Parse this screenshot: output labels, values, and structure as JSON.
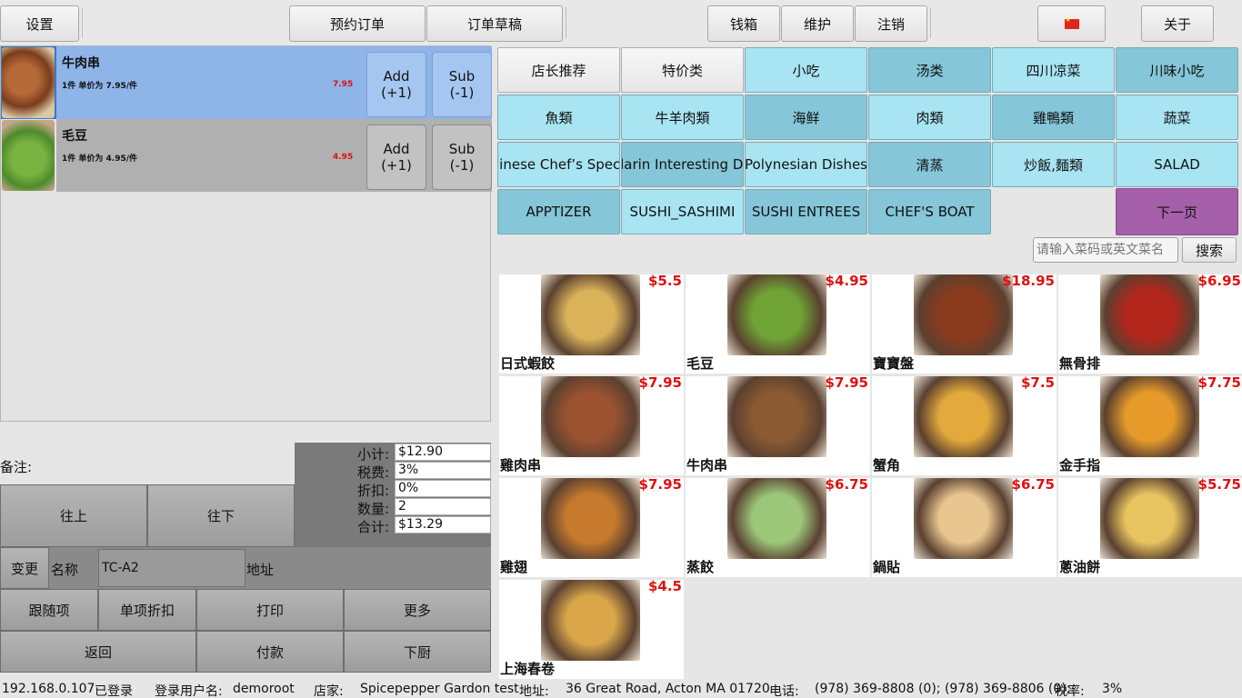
{
  "topbar": {
    "settings": "设置",
    "reservation": "预约订单",
    "draft": "订单草稿",
    "cashbox": "钱箱",
    "maintenance": "维护",
    "logout": "注销",
    "about": "关于",
    "flag_icon": "china-flag-icon"
  },
  "order": {
    "items": [
      {
        "name": "牛肉串",
        "desc": "1件 单价为 7.95/件",
        "price": "7.95",
        "add": "Add\n(+1)",
        "sub": "Sub\n(-1)"
      },
      {
        "name": "毛豆",
        "desc": "1件 单价为 4.95/件",
        "price": "4.95",
        "add": "Add\n(+1)",
        "sub": "Sub\n(-1)"
      }
    ]
  },
  "notes_label": "备注:",
  "summary": {
    "subtotal_label": "小计:",
    "subtotal": "$12.90",
    "tax_label": "税费:",
    "tax": "3%",
    "discount_label": "折扣:",
    "discount": "0%",
    "qty_label": "数量:",
    "qty": "2",
    "total_label": "合计:",
    "total": "$13.29"
  },
  "controls": {
    "up": "往上",
    "down": "往下",
    "change": "变更",
    "name_label": "名称",
    "name_value": "TC-A2",
    "address_label": "地址",
    "follow": "跟随项",
    "item_discount": "单项折扣",
    "print": "打印",
    "more": "更多",
    "back": "返回",
    "pay": "付款",
    "kitchen": "下厨"
  },
  "categories": [
    {
      "label": "店长推荐",
      "style": "white"
    },
    {
      "label": "特价类",
      "style": "white"
    },
    {
      "label": "小吃",
      "style": "light"
    },
    {
      "label": "汤类",
      "style": "dark"
    },
    {
      "label": "四川凉菜",
      "style": "light"
    },
    {
      "label": "川味小吃",
      "style": "dark"
    },
    {
      "label": "魚類",
      "style": "light"
    },
    {
      "label": "牛羊肉類",
      "style": "light"
    },
    {
      "label": "海鲜",
      "style": "dark"
    },
    {
      "label": "肉類",
      "style": "light"
    },
    {
      "label": "雞鴨類",
      "style": "dark"
    },
    {
      "label": "蔬菜",
      "style": "light"
    },
    {
      "label": "Chinese Chef’s Special",
      "style": "light"
    },
    {
      "label": "Mandarin Interesting Dishes",
      "style": "dark"
    },
    {
      "label": "Polynesian Dishes",
      "style": "light"
    },
    {
      "label": "清蒸",
      "style": "dark"
    },
    {
      "label": "炒飯,麵類",
      "style": "light"
    },
    {
      "label": "SALAD",
      "style": "light"
    },
    {
      "label": "APPTIZER",
      "style": "dark"
    },
    {
      "label": "SUSHI_SASHIMI",
      "style": "light"
    },
    {
      "label": "SUSHI ENTREES",
      "style": "dark"
    },
    {
      "label": "CHEF'S BOAT",
      "style": "dark"
    }
  ],
  "next_page": "下一页",
  "search": {
    "placeholder": "请输入菜码或英文菜名",
    "button": "搜索"
  },
  "dishes": [
    {
      "name": "日式蝦餃",
      "price": "$5.5",
      "color": "#d9b25a"
    },
    {
      "name": "毛豆",
      "price": "$4.95",
      "color": "#6fa336"
    },
    {
      "name": "寶寶盤",
      "price": "$18.95",
      "color": "#8a3b1e"
    },
    {
      "name": "無骨排",
      "price": "$6.95",
      "color": "#b3261c"
    },
    {
      "name": "雞肉串",
      "price": "$7.95",
      "color": "#9a5230"
    },
    {
      "name": "牛肉串",
      "price": "$7.95",
      "color": "#8b5a33"
    },
    {
      "name": "蟹角",
      "price": "$7.5",
      "color": "#e2a93c"
    },
    {
      "name": "金手指",
      "price": "$7.75",
      "color": "#e69a2a"
    },
    {
      "name": "雞翅",
      "price": "$7.95",
      "color": "#c77a2e"
    },
    {
      "name": "蒸餃",
      "price": "$6.75",
      "color": "#9cc77a"
    },
    {
      "name": "鍋貼",
      "price": "$6.75",
      "color": "#e9c68f"
    },
    {
      "name": "蔥油餅",
      "price": "$5.75",
      "color": "#e8c460"
    },
    {
      "name": "上海春卷",
      "price": "$4.5",
      "color": "#d9a64a"
    }
  ],
  "status": {
    "ip": "192.168.0.107",
    "login_state": "已登录",
    "user_label": "登录用户名:",
    "user": "demoroot",
    "store_label": "店家:",
    "store": "Spicepepper Gardon test",
    "addr_label": "地址:",
    "addr": "36 Great Road, Acton MA 01720",
    "phone_label": "电话:",
    "phone": "(978) 369-8808 (0); (978) 369-8806 (0);",
    "taxrate_label": "税率:",
    "taxrate": "3%"
  }
}
